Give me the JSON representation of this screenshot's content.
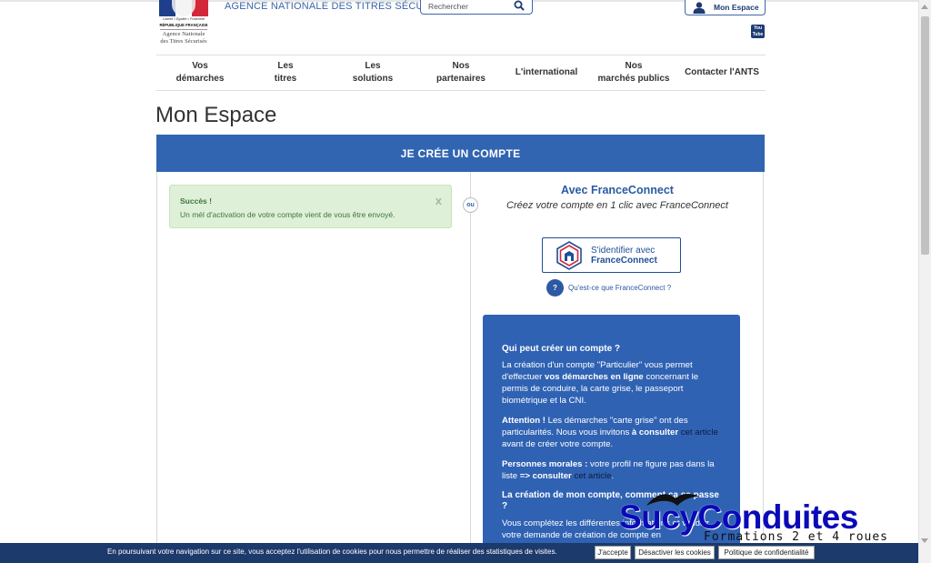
{
  "header": {
    "logo": {
      "motto": "Liberté • Égalité • Fraternité",
      "rf": "RÉPUBLIQUE FRANÇAISE",
      "agency_line1": "Agence Nationale",
      "agency_line2": "des Titres Sécurisés"
    },
    "agency_name": "AGENCE NATIONALE DES TITRES SÉCURISÉS",
    "search_placeholder": "Rechercher",
    "account_button": "Mon Espace",
    "youtube_line1": "You",
    "youtube_line2": "Tube"
  },
  "nav": {
    "items": [
      {
        "label": "Vos\ndémarches"
      },
      {
        "label": "Les\ntitres"
      },
      {
        "label": "Les\nsolutions"
      },
      {
        "label": "Nos\npartenaires"
      },
      {
        "label": "L'international"
      },
      {
        "label": "Nos\nmarchés publics"
      },
      {
        "label": "Contacter l'ANTS"
      }
    ]
  },
  "page_title": "Mon Espace",
  "card": {
    "header": "JE CRÉE UN COMPTE",
    "separator": "ou",
    "alert": {
      "title": "Succès !",
      "message": "Un mél d'activation de votre compte vient de vous être envoyé.",
      "close": "x"
    },
    "franceconnect": {
      "title": "Avec FranceConnect",
      "subtitle": "Créez votre compte en 1 clic avec FranceConnect",
      "button_line1": "S'identifier avec",
      "button_line2": "FranceConnect",
      "help_icon": "?",
      "help_link": "Qu'est-ce que FranceConnect ?"
    },
    "info": {
      "heading1": "Qui peut créer un compte ?",
      "p1_a": "La création d'un compte \"Particulier\" vous permet d'effectuer ",
      "p1_b": "vos démarches en ligne",
      "p1_c": " concernant le permis de conduire, la carte grise, le passeport biométrique et la CNI.",
      "p2_a": "Attention !",
      "p2_b": " Les démarches \"carte grise\" ont des particularités. Nous vous invitons ",
      "p2_c": "à consulter",
      "p2_link": "cet article",
      "p2_d": " avant de créer votre compte.",
      "p3_a": "Personnes morales :",
      "p3_b": " votre profil ne figure pas dans la liste ",
      "p3_c": "=> consulter",
      "p3_link": "cet article",
      "p3_d": ".",
      "heading2": "La création de mon compte, comment ça se passe ?",
      "p4": "Vous complétez les différentes informations et validez votre demande de création de compte en"
    }
  },
  "watermark": {
    "name": "SucyConduites",
    "tagline": "Formations 2 et 4 roues"
  },
  "cookie_bar": {
    "message": "En poursuivant votre navigation sur ce site, vous acceptez l'utilisation de cookies pour nous permettre de réaliser des statistiques de visites.",
    "accept": "J'accepte",
    "disable": "Désactiver les cookies",
    "policy": "Politique de confidentialité"
  },
  "colors": {
    "brand_blue": "#3165b1",
    "alert_green_bg": "#dff0d8",
    "alert_green_text": "#3c763d",
    "cookie_bar": "#1c3a6b"
  }
}
